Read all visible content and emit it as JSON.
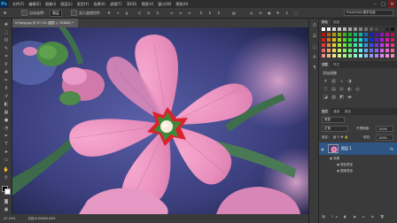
{
  "app": {
    "logo": "Ps"
  },
  "menu": [
    "文件(F)",
    "编辑(E)",
    "图像(I)",
    "图层(L)",
    "类型(Y)",
    "选择(S)",
    "滤镜(T)",
    "3D(D)",
    "视图(V)",
    "窗口(W)",
    "帮助(H)"
  ],
  "window_controls": {
    "minimize": "–",
    "maximize": "□",
    "close": "✕"
  },
  "options_bar": {
    "auto_select_label": "自动选择：",
    "auto_select_value": "图层",
    "show_transform_label": "显示变换控件",
    "workspace": "Essentials 基本功能"
  },
  "document": {
    "tab_title": "0.Pgng.jpg @ 47.1% (图层 1, RGB/8) *"
  },
  "status_bar": {
    "zoom": "47.19%",
    "doc_info": "文档:6.00M/6.00M"
  },
  "panels": {
    "color_tabs": [
      "颜色",
      "色板"
    ],
    "adjust_tabs": [
      "调整",
      "样式"
    ],
    "adjust_title": "添加调整",
    "layers_tabs": [
      "图层",
      "通道",
      "路径"
    ],
    "filter_kind": "类型",
    "blend_mode": "正常",
    "opacity_label": "不透明度:",
    "opacity_value": "100%",
    "lock_label": "锁定:",
    "fill_label": "填充:",
    "fill_value": "100%",
    "layer_name": "图层 1",
    "effects_label": "效果",
    "sub_effect": "颜色叠加",
    "sub_effect2": "图案叠加"
  },
  "colors": {
    "accent": "#31a8ff",
    "fg": "#000000",
    "bg": "#ffffff"
  }
}
